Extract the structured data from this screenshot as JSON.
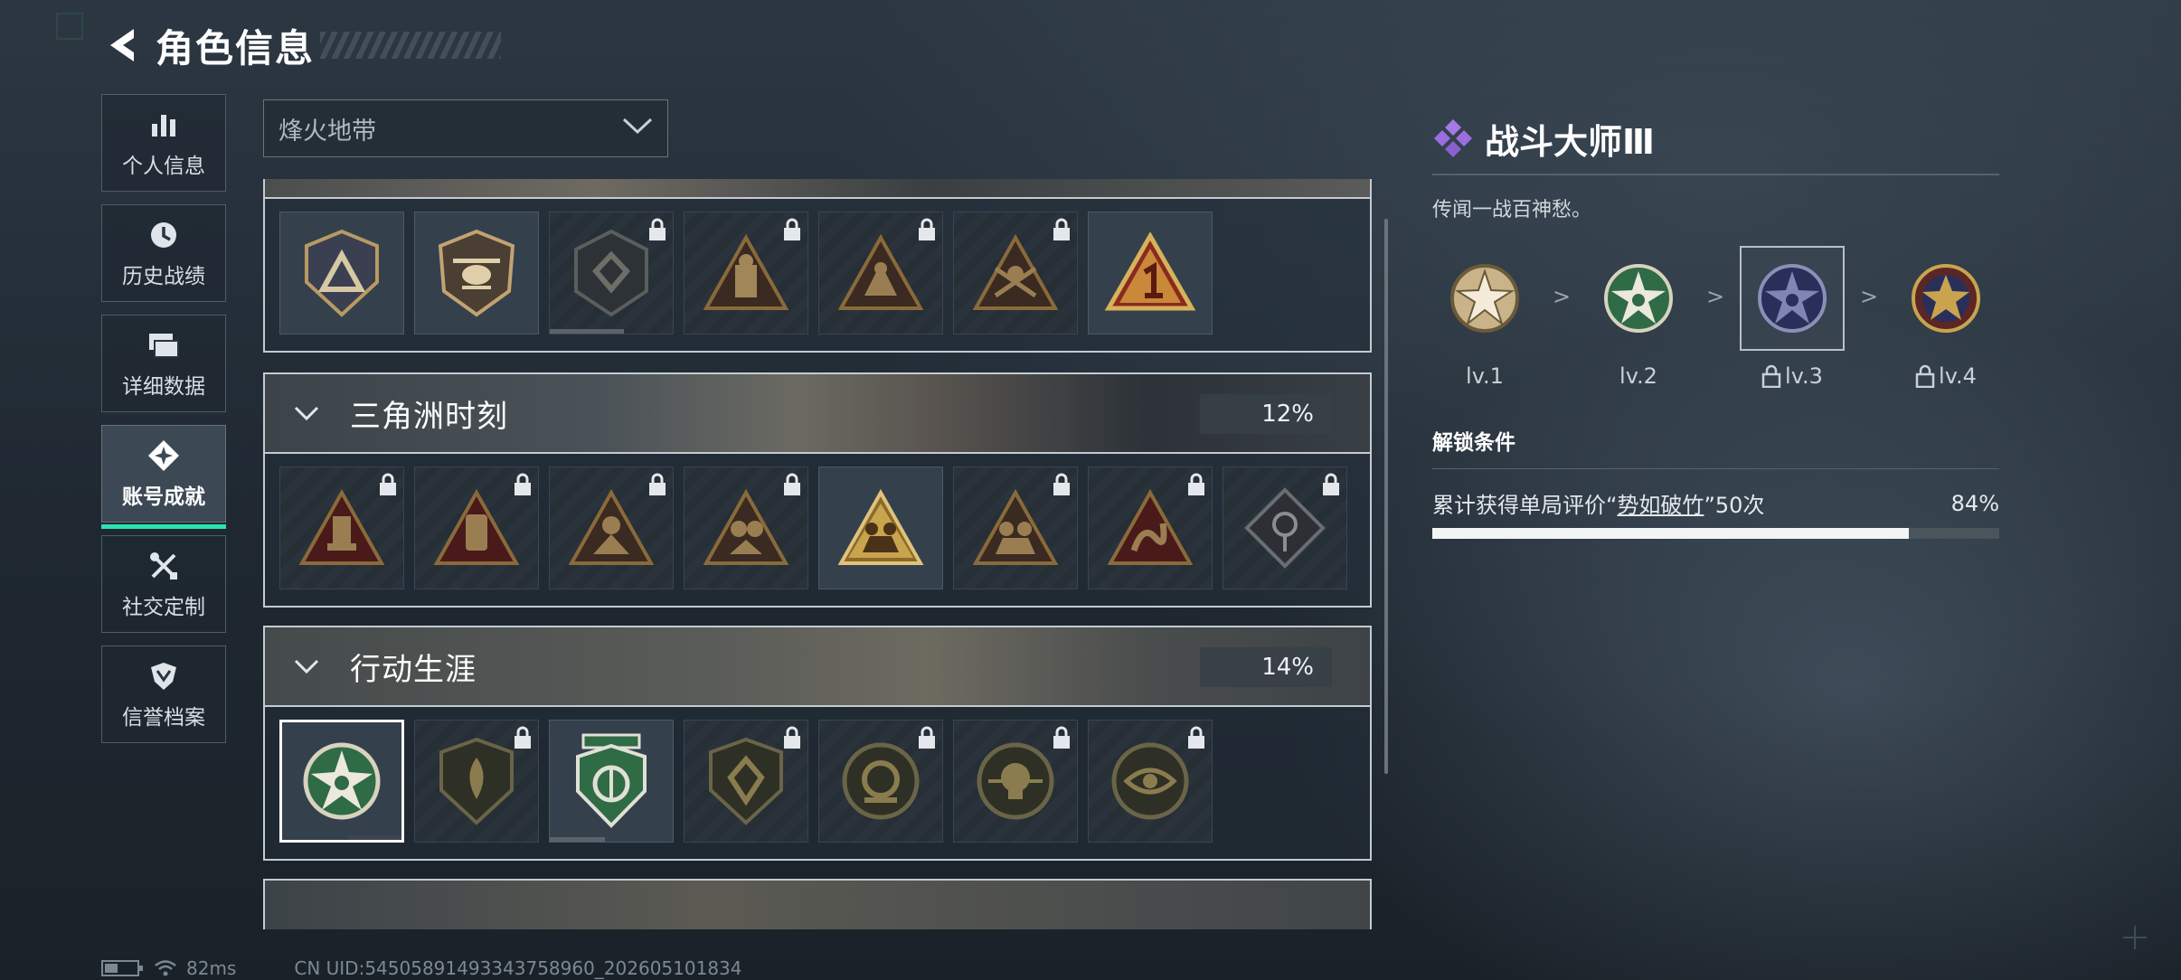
{
  "header": {
    "title": "角色信息"
  },
  "sidebar": {
    "items": [
      {
        "label": "个人信息",
        "icon": "bar-chart-icon"
      },
      {
        "label": "历史战绩",
        "icon": "history-icon"
      },
      {
        "label": "详细数据",
        "icon": "data-cards-icon"
      },
      {
        "label": "账号成就",
        "icon": "achievement-icon",
        "active": true
      },
      {
        "label": "社交定制",
        "icon": "tools-icon"
      },
      {
        "label": "信誉档案",
        "icon": "credibility-icon"
      }
    ]
  },
  "filter": {
    "selected": "烽火地带"
  },
  "categories": [
    {
      "name": "三角洲时刻",
      "percent": "12%"
    },
    {
      "name": "行动生涯",
      "percent": "14%"
    }
  ],
  "detail": {
    "title": "战斗大师Ⅲ",
    "description": "传闻一战百神愁。",
    "levels": [
      {
        "label": "lv.1",
        "locked": false
      },
      {
        "label": "lv.2",
        "locked": false
      },
      {
        "label": "lv.3",
        "locked": true
      },
      {
        "label": "lv.4",
        "locked": true
      }
    ],
    "separator": ">",
    "unlock_title": "解锁条件",
    "condition": {
      "prefix": "累计获得单局评价“",
      "highlight": "势如破竹",
      "suffix": "”50次"
    },
    "progress_text": "84%",
    "progress_value": 0.84
  },
  "status": {
    "ping": "82ms",
    "uid": "CN UID:54505891493343758960_202605101834"
  },
  "colors": {
    "accent": "#2ee2b0",
    "gold": "#c9a84e",
    "green": "#2f6b45",
    "purple": "#9b6ee0"
  }
}
